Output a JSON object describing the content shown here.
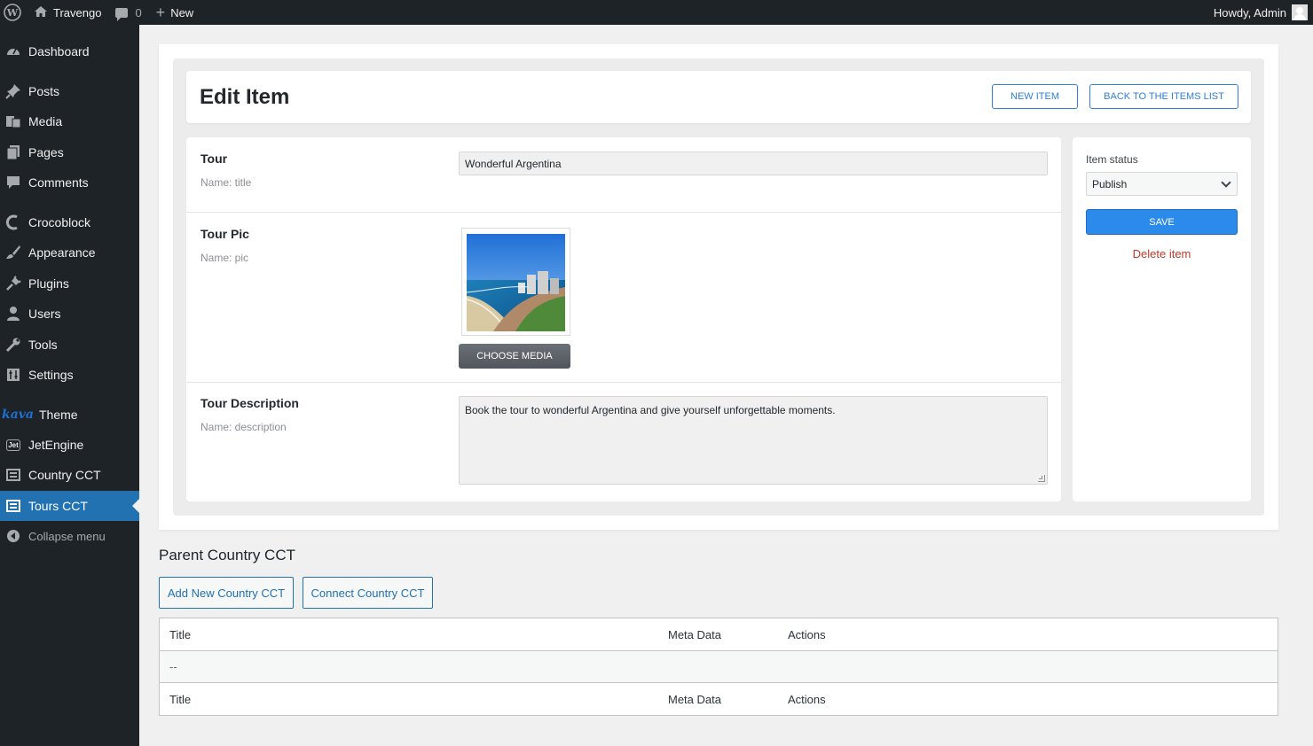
{
  "adminbar": {
    "site_name": "Travengo",
    "comments_count": "0",
    "new_label": "New",
    "howdy": "Howdy, Admin"
  },
  "sidebar": {
    "items": [
      {
        "label": "Dashboard",
        "icon": "dashboard-icon"
      },
      {
        "label": "Posts",
        "icon": "pin-icon"
      },
      {
        "label": "Media",
        "icon": "media-icon"
      },
      {
        "label": "Pages",
        "icon": "pages-icon"
      },
      {
        "label": "Comments",
        "icon": "comment-icon"
      },
      {
        "label": "Crocoblock",
        "icon": "crocoblock-icon"
      },
      {
        "label": "Appearance",
        "icon": "brush-icon"
      },
      {
        "label": "Plugins",
        "icon": "plug-icon"
      },
      {
        "label": "Users",
        "icon": "user-icon"
      },
      {
        "label": "Tools",
        "icon": "wrench-icon"
      },
      {
        "label": "Settings",
        "icon": "settings-icon"
      },
      {
        "label": "Theme",
        "icon": "kava-logo",
        "prefix": "kava"
      },
      {
        "label": "JetEngine",
        "icon": "jetengine-icon",
        "prefix": "Jet"
      },
      {
        "label": "Country CCT",
        "icon": "list-icon"
      },
      {
        "label": "Tours CCT",
        "icon": "list-icon",
        "active": true
      },
      {
        "label": "Collapse menu",
        "icon": "collapse-icon"
      }
    ]
  },
  "editor": {
    "title": "Edit Item",
    "new_item_label": "NEW ITEM",
    "back_label": "BACK TO THE ITEMS LIST",
    "fields": [
      {
        "label": "Tour",
        "name": "Name: title",
        "value": "Wonderful Argentina"
      },
      {
        "label": "Tour Pic",
        "name": "Name: pic",
        "button": "CHOOSE MEDIA"
      },
      {
        "label": "Tour Description",
        "name": "Name: description",
        "value": "Book the tour to wonderful Argentina and give yourself unforgettable moments."
      }
    ],
    "status": {
      "label": "Item status",
      "selected": "Publish",
      "save_label": "SAVE",
      "delete_label": "Delete item"
    }
  },
  "parent": {
    "title": "Parent Country CCT",
    "add_label": "Add New Country CCT",
    "connect_label": "Connect Country CCT",
    "columns": [
      "Title",
      "Meta Data",
      "Actions"
    ],
    "empty_row": "--"
  },
  "colors": {
    "admin_dark": "#1d2327",
    "active_blue": "#2271b1",
    "save_blue": "#2c8bea",
    "delete_red": "#c0392b"
  }
}
